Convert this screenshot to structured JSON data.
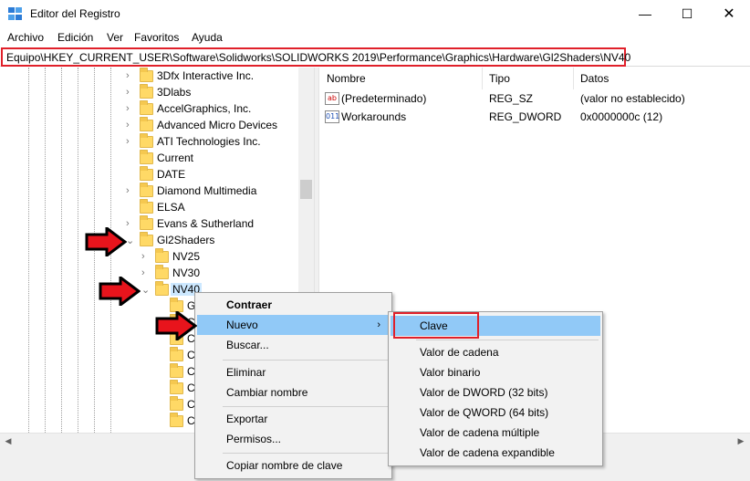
{
  "window": {
    "title": "Editor del Registro",
    "controls": {
      "minimize": "—",
      "maximize": "☐",
      "close": "✕"
    }
  },
  "menu": {
    "items": [
      {
        "label": "Archivo"
      },
      {
        "label": "Edición"
      },
      {
        "label": "Ver"
      },
      {
        "label": "Favoritos"
      },
      {
        "label": "Ayuda"
      }
    ]
  },
  "address": {
    "path": "Equipo\\HKEY_CURRENT_USER\\Software\\Solidworks\\SOLIDWORKS 2019\\Performance\\Graphics\\Hardware\\Gl2Shaders\\NV40"
  },
  "tree": {
    "items": [
      {
        "label": "3Dfx Interactive Inc.",
        "expander": "›"
      },
      {
        "label": "3Dlabs",
        "expander": "›"
      },
      {
        "label": "AccelGraphics, Inc.",
        "expander": "›"
      },
      {
        "label": "Advanced Micro Devices",
        "expander": "›"
      },
      {
        "label": "ATI Technologies Inc.",
        "expander": "›"
      },
      {
        "label": "Current",
        "expander": ""
      },
      {
        "label": "DATE",
        "expander": ""
      },
      {
        "label": "Diamond Multimedia",
        "expander": "›"
      },
      {
        "label": "ELSA",
        "expander": ""
      },
      {
        "label": "Evans & Sutherland",
        "expander": "›"
      },
      {
        "label": "Gl2Shaders",
        "expander": "⌄"
      },
      {
        "label": "NV25",
        "expander": "›"
      },
      {
        "label": "NV30",
        "expander": "›"
      },
      {
        "label": "NV40",
        "expander": "⌄"
      },
      {
        "label": "G",
        "expander": ""
      },
      {
        "label": "C",
        "expander": ""
      },
      {
        "label": "C",
        "expander": ""
      },
      {
        "label": "C",
        "expander": ""
      },
      {
        "label": "C",
        "expander": ""
      },
      {
        "label": "C",
        "expander": ""
      },
      {
        "label": "C",
        "expander": ""
      },
      {
        "label": "C",
        "expander": ""
      }
    ]
  },
  "list": {
    "headers": {
      "name": "Nombre",
      "type": "Tipo",
      "data": "Datos"
    },
    "rows": [
      {
        "icon": "ab",
        "name": "(Predeterminado)",
        "type": "REG_SZ",
        "data": "(valor no establecido)"
      },
      {
        "icon": "011",
        "name": "Workarounds",
        "type": "REG_DWORD",
        "data": "0x0000000c (12)"
      }
    ]
  },
  "context_menu": {
    "items": [
      {
        "label": "Contraer"
      },
      {
        "label": "Nuevo",
        "submenu_arrow": "›"
      },
      {
        "label": "Buscar..."
      },
      {
        "label": "Eliminar"
      },
      {
        "label": "Cambiar nombre"
      },
      {
        "label": "Exportar"
      },
      {
        "label": "Permisos..."
      },
      {
        "label": "Copiar nombre de clave"
      }
    ]
  },
  "submenu": {
    "items": [
      {
        "label": "Clave"
      },
      {
        "label": "Valor de cadena"
      },
      {
        "label": "Valor binario"
      },
      {
        "label": "Valor de DWORD (32 bits)"
      },
      {
        "label": "Valor de QWORD (64 bits)"
      },
      {
        "label": "Valor de cadena múltiple"
      },
      {
        "label": "Valor de cadena expandible"
      }
    ]
  },
  "scroll": {
    "left_arrow": "◀",
    "right_arrow": "▶"
  },
  "colors": {
    "highlight_border": "#e0202a",
    "menu_hover": "#91c9f7",
    "arrow_fill": "#e8141c"
  }
}
